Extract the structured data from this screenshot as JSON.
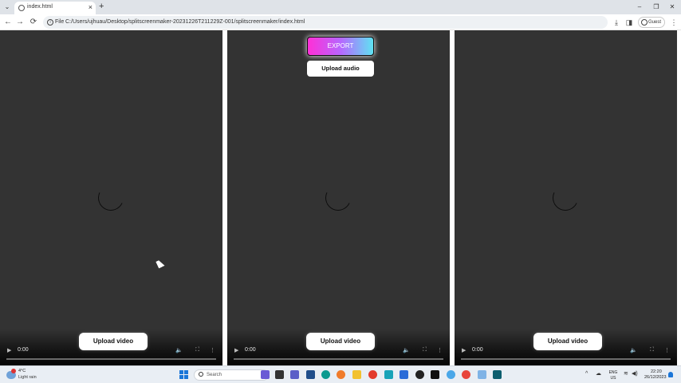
{
  "browser": {
    "tab_title": "index.html",
    "tab_close": "×",
    "new_tab": "+",
    "tab_dropdown": "⌄",
    "window_controls": [
      "–",
      "❐",
      "✕"
    ],
    "back": "←",
    "forward": "→",
    "reload": "⟳",
    "site_info": "i",
    "file_chip": "File",
    "url": "C:/Users/ujhuau/Desktop/splitscreenmaker-20231226T211229Z-001/splitscreenmaker/index.html",
    "download_icon": "⤓",
    "sidepanel_icon": "◨",
    "guest_label": "Guest",
    "menu_icon": "⋮"
  },
  "page": {
    "export_label": "EXPORT",
    "upload_audio_label": "Upload audio",
    "panels": [
      {
        "upload_label": "Upload video",
        "time": "0:00"
      },
      {
        "upload_label": "Upload video",
        "time": "0:00"
      },
      {
        "upload_label": "Upload video",
        "time": "0:00"
      }
    ],
    "controls": {
      "play": "▶",
      "volume": "🔈",
      "fullscreen": "⛶",
      "more": "⋮"
    }
  },
  "taskbar": {
    "weather_temp": "4°C",
    "weather_desc": "Light rain",
    "search_label": "Search",
    "tray_chevron": "^",
    "lang_top": "ENG",
    "lang_bottom": "US",
    "wifi": "≋",
    "speaker": "◀)",
    "time": "22:20",
    "date": "26/12/2023"
  },
  "colors": {
    "panel_bg": "#333333",
    "export_gradient": [
      "#ff2fd6",
      "#b766ff",
      "#5fe3f2"
    ],
    "taskbar_bg": "#e9eef4"
  }
}
